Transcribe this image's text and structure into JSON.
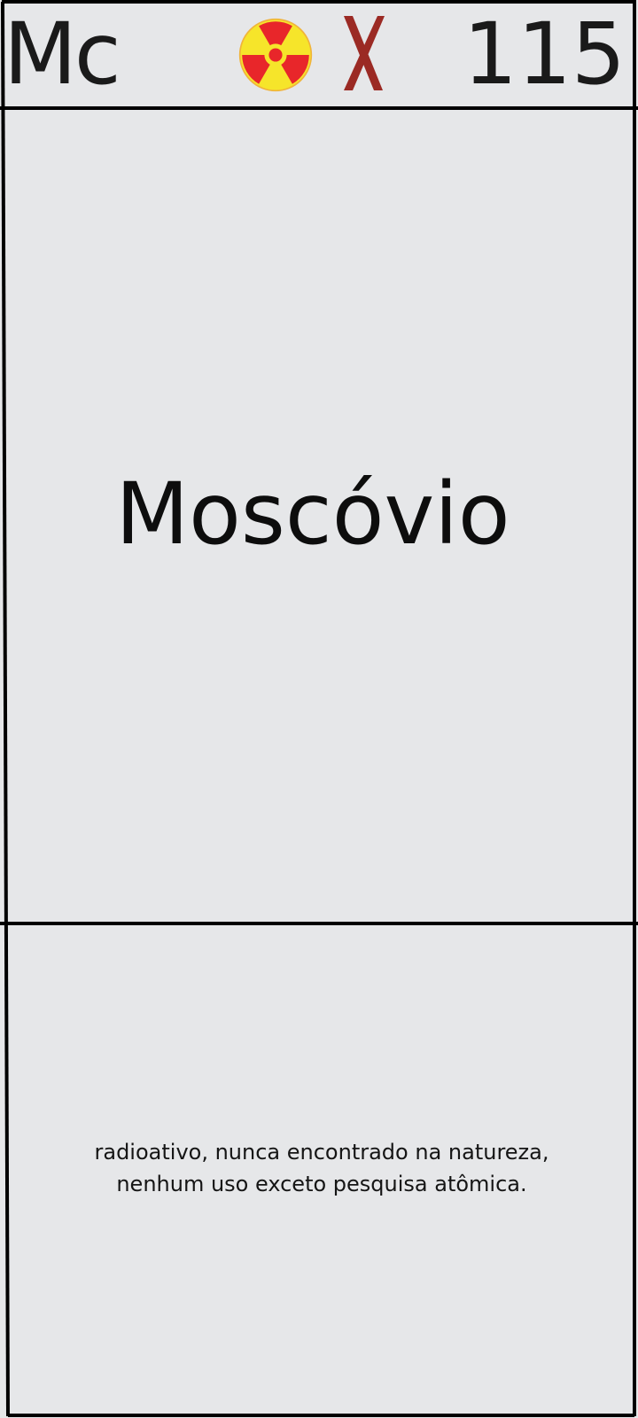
{
  "element": {
    "symbol": "Mc",
    "atomic_number": "115",
    "name": "Moscóvio",
    "description_line1": "radioativo, nunca encontrado na natureza,",
    "description_line2": "nenhum uso exceto pesquisa atômica."
  },
  "icons": {
    "hazard": "radioactive-icon",
    "status": "x-mark-icon"
  },
  "colors": {
    "background": "#e6e7e9",
    "border": "#000000",
    "radioactive_fill": "#f6e52a",
    "radioactive_symbol": "#e8262a",
    "x_mark": "#9b2a24"
  }
}
